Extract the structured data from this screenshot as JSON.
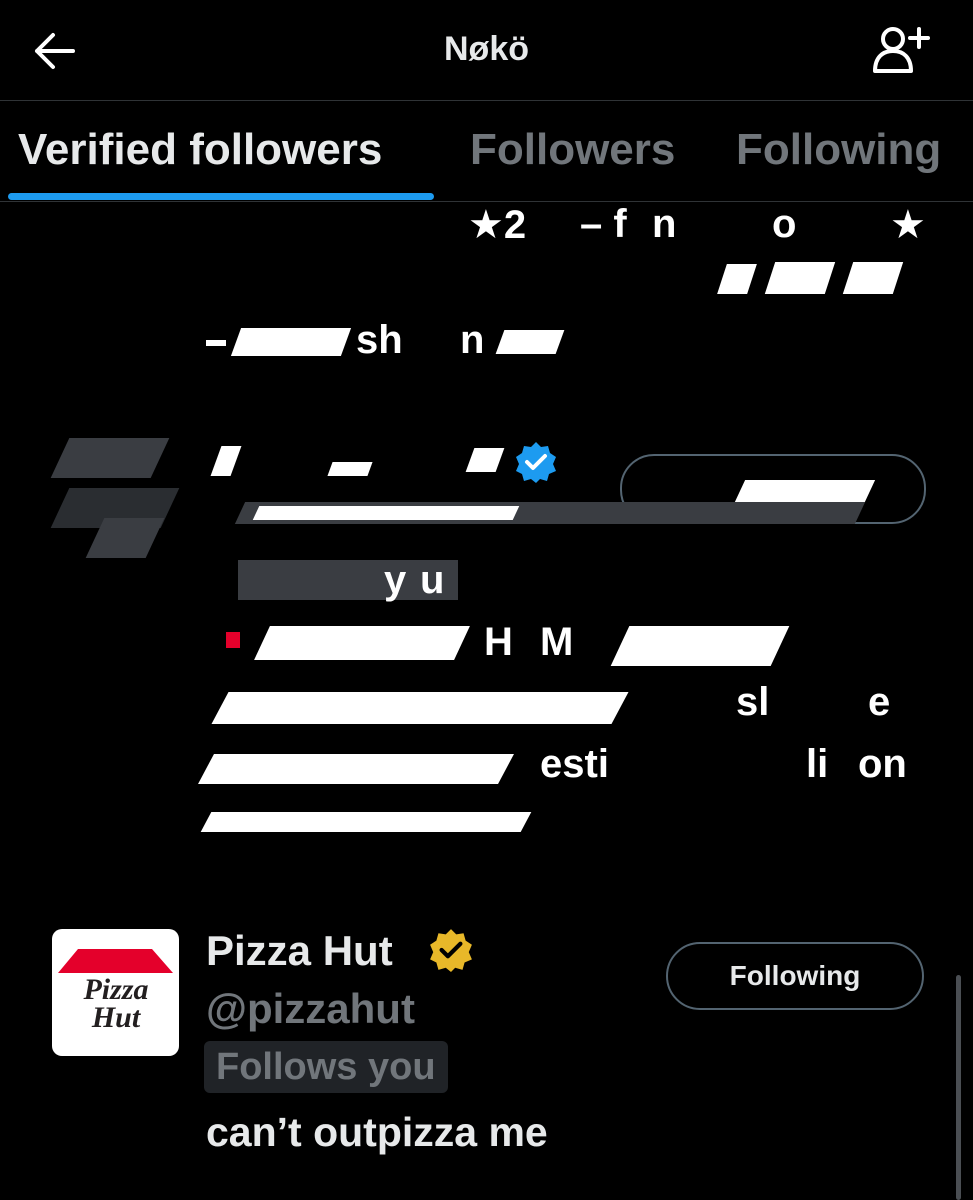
{
  "header": {
    "title": "Nøkö",
    "back_icon": "arrow-left-icon",
    "add_user_icon": "person-add-icon"
  },
  "tabs": [
    {
      "label": "Verified followers",
      "active": true
    },
    {
      "label": "Followers",
      "active": false
    },
    {
      "label": "Following",
      "active": false
    }
  ],
  "obscured_row": {
    "fragments": [
      "★2",
      "– f",
      "n",
      "o",
      "★",
      "sh",
      "n",
      "y",
      "u",
      "H",
      "M",
      "sl",
      "e",
      "esti",
      "on",
      "li"
    ],
    "verified_badge_color": "#1d9bf0"
  },
  "user": {
    "display_name": "Pizza Hut",
    "handle": "@pizzahut",
    "follows_you_label": "Follows you",
    "bio": "can’t outpizza me",
    "follow_button_label": "Following",
    "verified_badge_color": "#e8b829",
    "avatar": {
      "logo_text_line1": "Pizza",
      "logo_text_line2": "Hut",
      "roof_color": "#e4002b",
      "text_color": "#231f20"
    }
  },
  "colors": {
    "accent": "#1d9bf0",
    "muted_text": "#71767b",
    "primary_text": "#e7e9ea",
    "divider": "#2f3336"
  }
}
